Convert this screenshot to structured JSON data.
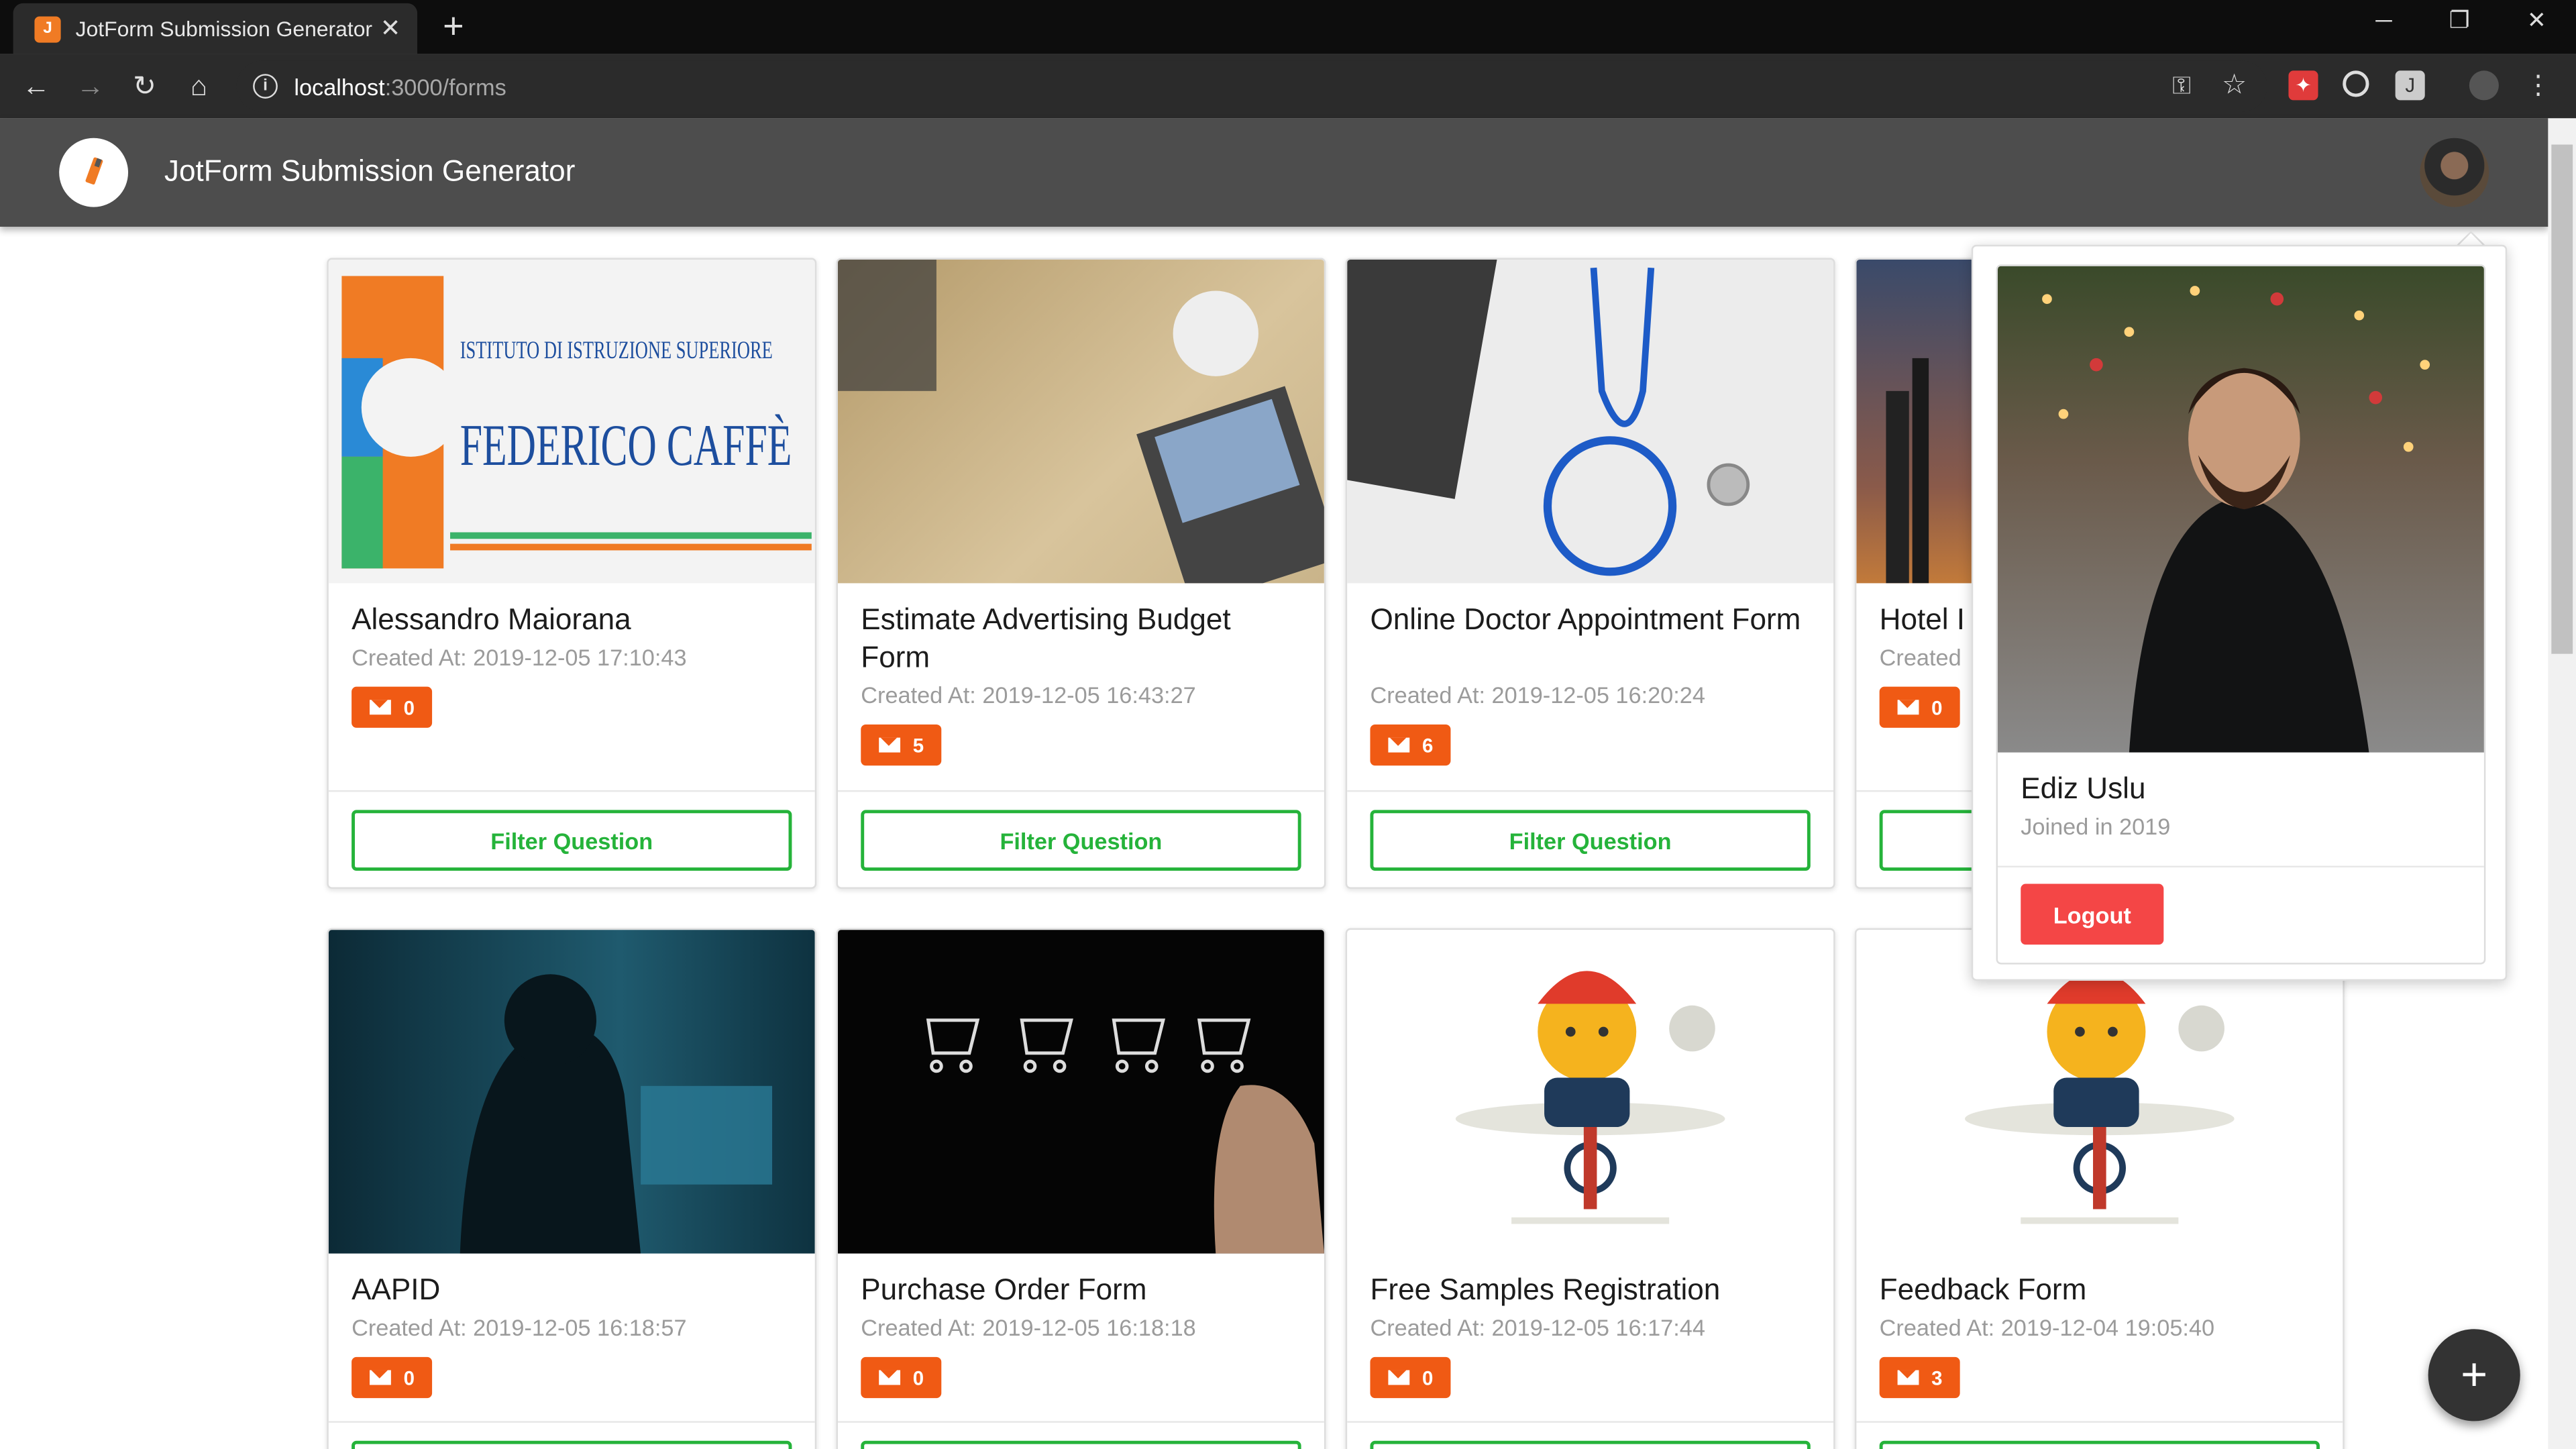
{
  "browser": {
    "tab_title": "JotForm Submission Generator",
    "url_host": "localhost",
    "url_path": ":3000/forms"
  },
  "app": {
    "title": "JotForm Submission Generator"
  },
  "cards": [
    {
      "title": "Alessandro Maiorana",
      "created": "Created At: 2019-12-05 17:10:43",
      "count": "0",
      "button": "Filter Question",
      "image_text_1": "ISTITUTO DI ISTRUZIONE SUPERIORE",
      "image_text_2": "FEDERICO CAFFÈ"
    },
    {
      "title": "Estimate Advertising Budget Form",
      "created": "Created At: 2019-12-05 16:43:27",
      "count": "5",
      "button": "Filter Question"
    },
    {
      "title": "Online Doctor Appointment Form",
      "created": "Created At: 2019-12-05 16:20:24",
      "count": "6",
      "button": "Filter Question"
    },
    {
      "title": "Hotel I",
      "created": "Created",
      "count": "0",
      "button": ""
    },
    {
      "title": "AAPID",
      "created": "Created At: 2019-12-05 16:18:57",
      "count": "0",
      "button": ""
    },
    {
      "title": "Purchase Order Form",
      "created": "Created At: 2019-12-05 16:18:18",
      "count": "0",
      "button": ""
    },
    {
      "title": "Free Samples Registration",
      "created": "Created At: 2019-12-05 16:17:44",
      "count": "0",
      "button": ""
    },
    {
      "title": "Feedback Form",
      "created": "Created At: 2019-12-04 19:05:40",
      "count": "3",
      "button": ""
    }
  ],
  "profile": {
    "name": "Ediz Uslu",
    "joined": "Joined in 2019",
    "logout_label": "Logout"
  },
  "fab": {
    "label": "+"
  },
  "colors": {
    "accent_green": "#25b33a",
    "badge_orange": "#f05a14",
    "logout_red": "#f44646",
    "header": "#4d4d4d"
  }
}
